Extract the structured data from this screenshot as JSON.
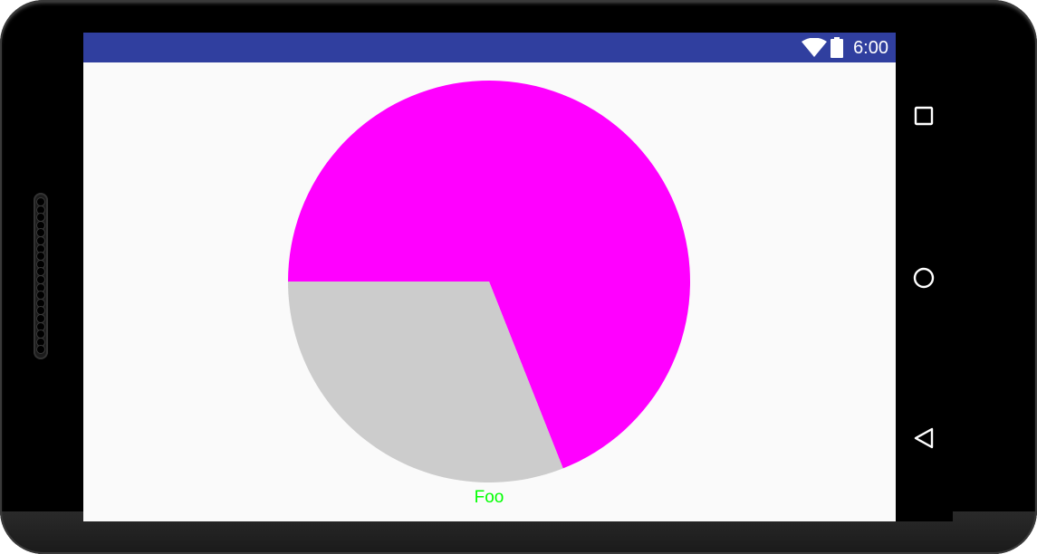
{
  "status_bar": {
    "time": "6:00",
    "background": "#303f9f",
    "icons": [
      "wifi-icon",
      "battery-icon"
    ]
  },
  "nav_bar": {
    "buttons": [
      "recent-apps-icon",
      "home-icon",
      "back-icon"
    ]
  },
  "chart_data": {
    "type": "pie",
    "start_angle_deg": 180,
    "direction": "clockwise",
    "slices": [
      {
        "value": 0.69,
        "color": "#ff00ff"
      },
      {
        "value": 0.31,
        "color": "#cccccc"
      }
    ],
    "label": {
      "text": "Foo",
      "color": "#00ff00"
    }
  }
}
